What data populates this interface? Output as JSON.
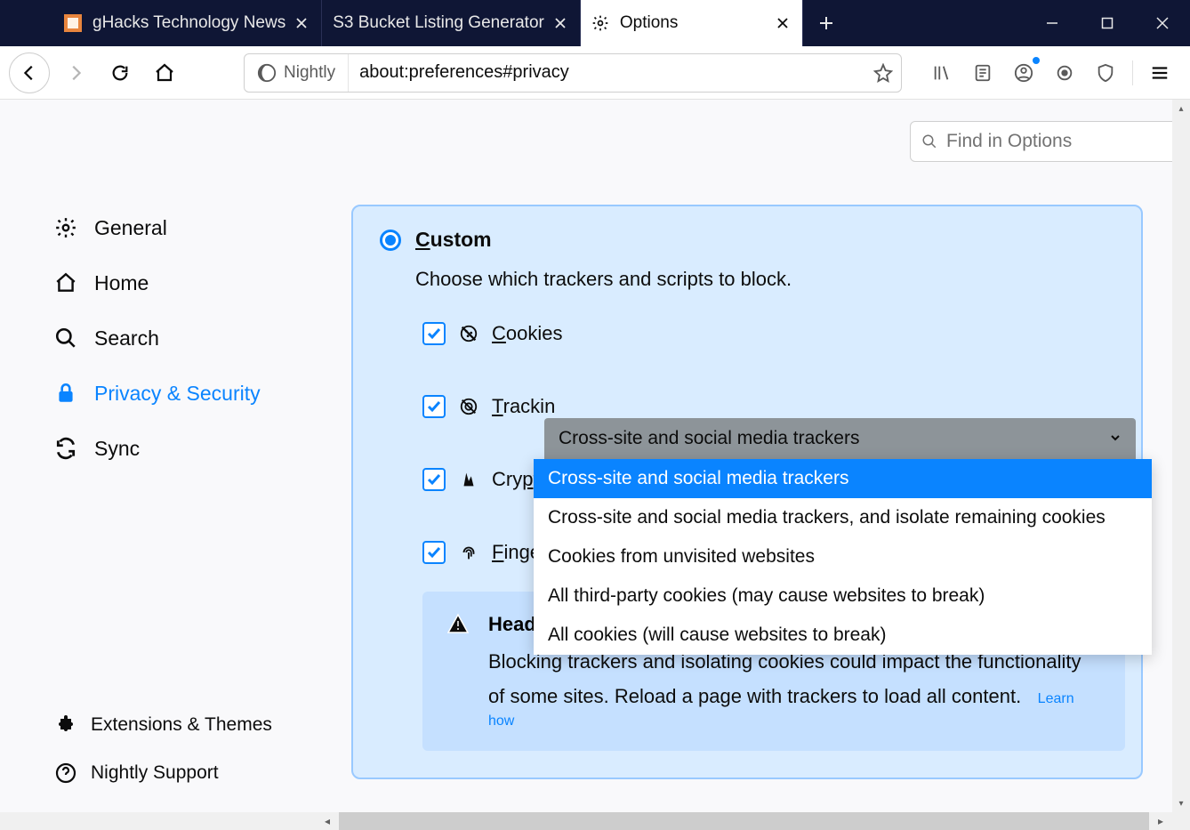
{
  "tabs": [
    {
      "label": "gHacks Technology News",
      "favicon_color": "#e8853e"
    },
    {
      "label": "S3 Bucket Listing Generator"
    },
    {
      "label": "Options",
      "active": true
    }
  ],
  "url": {
    "identity": "Nightly",
    "value": "about:preferences#privacy"
  },
  "find_placeholder": "Find in Options",
  "sidebar": {
    "items": [
      {
        "label": "General"
      },
      {
        "label": "Home"
      },
      {
        "label": "Search"
      },
      {
        "label": "Privacy & Security",
        "active": true
      },
      {
        "label": "Sync"
      }
    ],
    "bottom": [
      {
        "label": "Extensions & Themes"
      },
      {
        "label": "Nightly Support"
      }
    ]
  },
  "panel": {
    "custom_label": "Custom",
    "custom_desc": "Choose which trackers and scripts to block.",
    "rows": {
      "cookies": "Cookies",
      "tracking": "Trackin",
      "crypto": "Crypto",
      "fingerprinters": "Fingerprinters"
    },
    "dropdown_selected": "Cross-site and social media trackers",
    "dropdown_options": [
      "Cross-site and social media trackers",
      "Cross-site and social media trackers, and isolate remaining cookies",
      "Cookies from unvisited websites",
      "All third-party cookies (may cause websites to break)",
      "All cookies (will cause websites to break)"
    ],
    "infobox": {
      "title": "Heads up!",
      "body": "Blocking trackers and isolating cookies could impact the functionality of some sites. Reload a page with trackers to load all content.",
      "learn": "Learn how"
    }
  }
}
